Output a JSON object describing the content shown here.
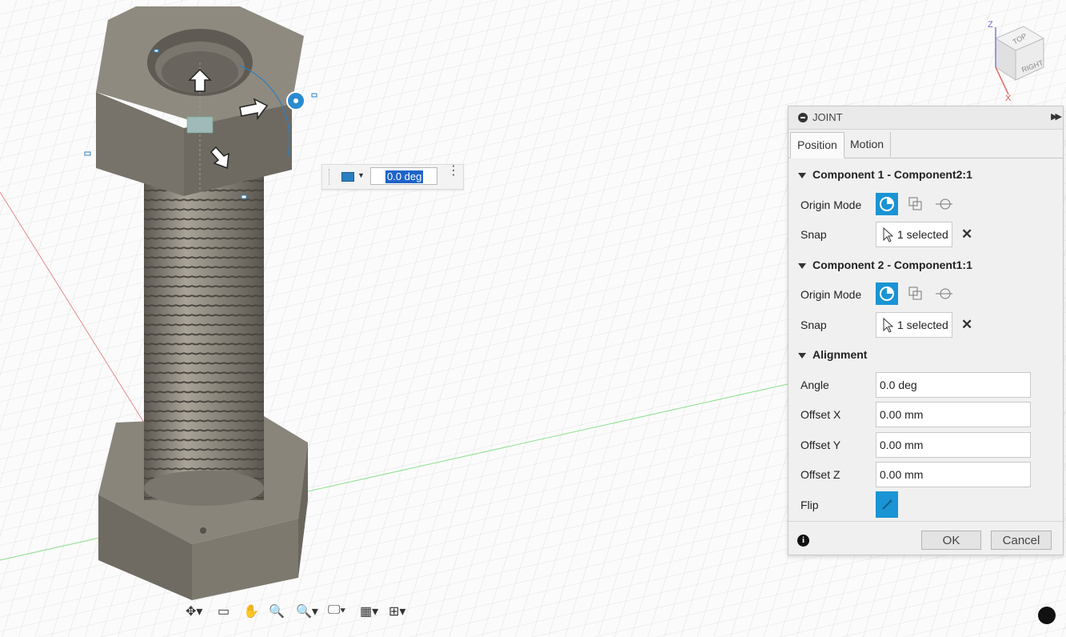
{
  "viewcube": {
    "top_label": "TOP",
    "right_label": "RIGHT",
    "z_axis": "Z",
    "x_axis": "X"
  },
  "inline_editor": {
    "value": "0.0 deg"
  },
  "joint_panel": {
    "title": "JOINT",
    "tabs": [
      {
        "label": "Position"
      },
      {
        "label": "Motion"
      }
    ],
    "component1": {
      "header": "Component 1 - Component2:1",
      "origin_mode_label": "Origin Mode",
      "snap_label": "Snap",
      "snap_value": "1 selected"
    },
    "component2": {
      "header": "Component 2 - Component1:1",
      "origin_mode_label": "Origin Mode",
      "snap_label": "Snap",
      "snap_value": "1 selected"
    },
    "alignment": {
      "header": "Alignment",
      "angle_label": "Angle",
      "angle_value": "0.0 deg",
      "offset_x_label": "Offset X",
      "offset_x_value": "0.00 mm",
      "offset_y_label": "Offset Y",
      "offset_y_value": "0.00 mm",
      "offset_z_label": "Offset Z",
      "offset_z_value": "0.00 mm",
      "flip_label": "Flip"
    },
    "ok_label": "OK",
    "cancel_label": "Cancel"
  },
  "colors": {
    "accent": "#1a94d4",
    "model": "#7d786f",
    "grid": "#d4d4d4"
  }
}
